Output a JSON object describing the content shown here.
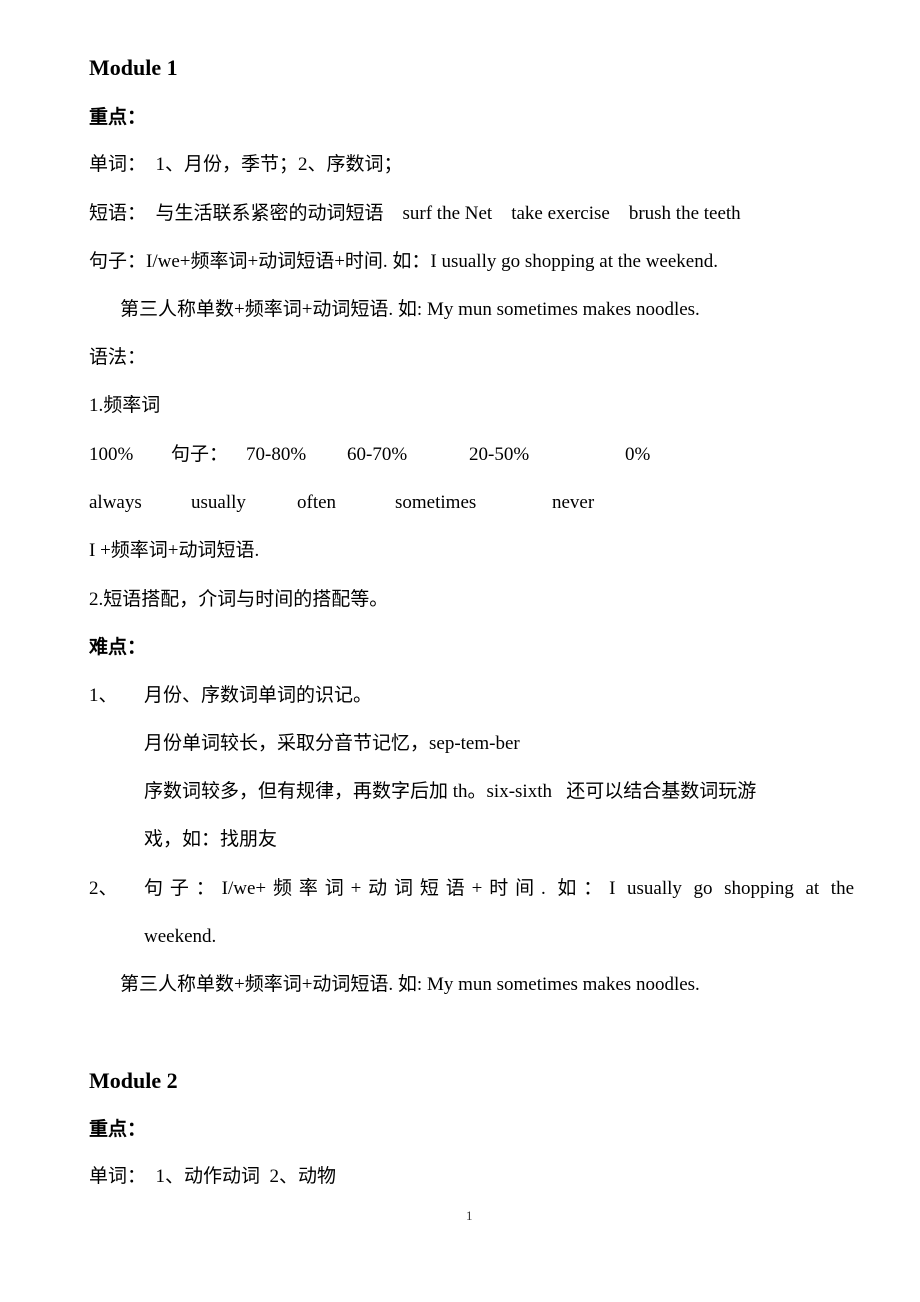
{
  "page_number": "1",
  "module1": {
    "title": "Module 1",
    "key_points_heading": "重点：",
    "vocab_line": "单词：  1、月份，季节；2、序数词；",
    "phrases_line": "短语：  与生活联系紧密的动词短语    surf the Net    take exercise    brush the teeth",
    "sentence_line": "句子：I/we+频率词+动词短语+时间. 如：I usually go shopping at the weekend.",
    "sentence_line2": "第三人称单数+频率词+动词短语. 如: My mun sometimes makes noodles.",
    "grammar_heading": "语法：",
    "grammar_item1": "1.频率词",
    "percent_row": [
      "100%",
      "句子：",
      "70-80%",
      "60-70%",
      "20-50%",
      "0%"
    ],
    "frequency_words": [
      "always",
      "usually",
      "often",
      "sometimes",
      "never"
    ],
    "pattern_line": "I +频率词+动词短语.",
    "grammar_item2": "2.短语搭配，介词与时间的搭配等。",
    "difficulties_heading": "难点：",
    "difficulty1_num": "1、",
    "difficulty1_text": "月份、序数词单词的识记。",
    "difficulty1_note1": "月份单词较长，采取分音节记忆，sep-tem-ber",
    "difficulty1_note2": "序数词较多，但有规律，再数字后加 th。six-sixth   还可以结合基数词玩游",
    "difficulty1_note2_cont": "戏，如：找朋友",
    "difficulty2_num": "2、",
    "difficulty2_text": "句子：I/we+频率词+动词短语+时间. 如：I usually go shopping at the",
    "difficulty2_cont": "weekend.",
    "difficulty2_line2": "第三人称单数+频率词+动词短语. 如: My mun sometimes makes noodles."
  },
  "module2": {
    "title": "Module 2",
    "key_points_heading": "重点：",
    "vocab_line": "单词：  1、动作动词  2、动物"
  }
}
